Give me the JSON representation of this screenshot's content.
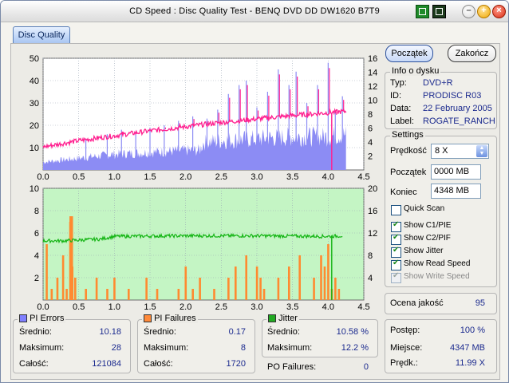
{
  "window": {
    "title": "CD Speed : Disc Quality Test - BENQ    DVD DD DW1620    B7T9"
  },
  "tabs": [
    {
      "label": "Disc Quality"
    }
  ],
  "buttons": {
    "start": "Początek",
    "end": "Zakończ"
  },
  "disc_info": {
    "title": "Info o dysku",
    "rows": [
      {
        "label": "Typ:",
        "value": "DVD+R"
      },
      {
        "label": "ID:",
        "value": "PRODISC R03"
      },
      {
        "label": "Data:",
        "value": "22 February 2005"
      },
      {
        "label": "Label:",
        "value": "ROGATE_RANCH"
      }
    ]
  },
  "settings": {
    "title": "Settings",
    "speed_label": "Prędkość",
    "speed_value": "8 X",
    "start_label": "Początek",
    "start_value": "0000 MB",
    "end_label": "Koniec",
    "end_value": "4348 MB",
    "options": [
      {
        "label": "Quick Scan",
        "checked": false,
        "disabled": false
      },
      {
        "label": "Show C1/PIE",
        "checked": true,
        "disabled": false
      },
      {
        "label": "Show C2/PIF",
        "checked": true,
        "disabled": false
      },
      {
        "label": "Show Jitter",
        "checked": true,
        "disabled": false
      },
      {
        "label": "Show Read Speed",
        "checked": true,
        "disabled": false
      },
      {
        "label": "Show Write Speed",
        "checked": true,
        "disabled": true
      }
    ]
  },
  "quality": {
    "label": "Ocena jakość",
    "value": "95"
  },
  "progress": {
    "rows": [
      {
        "label": "Postęp:",
        "value": "100 %"
      },
      {
        "label": "Miejsce:",
        "value": "4347 MB"
      },
      {
        "label": "Prędk.:",
        "value": "11.99 X"
      }
    ]
  },
  "stats": {
    "pi_errors": {
      "title": "PI Errors",
      "color": "#8080ff",
      "rows": [
        {
          "label": "Średnio:",
          "value": "10.18"
        },
        {
          "label": "Maksimum:",
          "value": "28"
        },
        {
          "label": "Całość:",
          "value": "121084"
        }
      ]
    },
    "pi_failures": {
      "title": "PI Failures",
      "color": "#ff8a3a",
      "rows": [
        {
          "label": "Średnio:",
          "value": "0.17"
        },
        {
          "label": "Maksimum:",
          "value": "8"
        },
        {
          "label": "Całość:",
          "value": "1720"
        }
      ]
    },
    "jitter": {
      "title": "Jitter",
      "color": "#22aa22",
      "rows": [
        {
          "label": "Średnio:",
          "value": "10.58 %"
        },
        {
          "label": "Maksimum:",
          "value": "12.2 %"
        }
      ]
    },
    "po_failures": {
      "label": "PO Failures:",
      "value": "0"
    }
  },
  "colors": {
    "upper_bg": "#ffffff",
    "lower_bg": "#c4f5c4",
    "pie_fill": "#8c8cf4",
    "read_speed": "#ff1f8f",
    "pif_fill": "#ff8a30",
    "jitter": "#13b413"
  },
  "chart_data": [
    {
      "type": "bar",
      "description_series": "PI Errors (bars) with read speed line",
      "x_ticks": [
        "0.0",
        "0.5",
        "1.0",
        "1.5",
        "2.0",
        "2.5",
        "3.0",
        "3.5",
        "4.0",
        "4.5"
      ],
      "xlim": [
        0,
        4.5
      ],
      "y_left_ticks": [
        "10",
        "20",
        "30",
        "40",
        "50"
      ],
      "ylim_left": [
        0,
        50
      ],
      "y_right_ticks": [
        "2",
        "4",
        "6",
        "8",
        "10",
        "12",
        "14",
        "16"
      ],
      "ylim_right": [
        0,
        16
      ],
      "pie_profile": {
        "x": [
          0.0,
          0.5,
          1.0,
          1.5,
          2.0,
          2.2,
          2.25,
          2.5,
          3.0,
          3.5,
          4.0,
          4.15,
          4.25
        ],
        "y": [
          4,
          6,
          8,
          9,
          10,
          10,
          14,
          15,
          16,
          17,
          17,
          18,
          18
        ]
      },
      "pie_spikes": {
        "x": [
          0.6,
          0.9,
          1.1,
          1.3,
          1.5,
          1.7,
          1.9,
          2.1,
          2.3,
          2.45,
          2.6,
          2.75,
          2.85,
          3.0,
          3.15,
          3.3,
          3.45,
          3.55,
          3.7,
          3.85,
          4.0,
          4.1,
          4.2
        ],
        "y": [
          14,
          16,
          18,
          17,
          19,
          20,
          22,
          24,
          23,
          27,
          34,
          38,
          40,
          28,
          35,
          45,
          38,
          44,
          30,
          38,
          48,
          26,
          33
        ]
      },
      "read_speed": {
        "x": [
          0.0,
          0.5,
          1.0,
          1.5,
          2.0,
          2.5,
          3.0,
          3.5,
          4.0,
          4.25
        ],
        "y": [
          3.3,
          4.2,
          4.9,
          5.6,
          6.2,
          6.8,
          7.3,
          7.8,
          8.2,
          8.4
        ]
      }
    },
    {
      "type": "bar",
      "description_series": "PI Failures (bars) with jitter line",
      "x_ticks": [
        "0.0",
        "0.5",
        "1.0",
        "1.5",
        "2.0",
        "2.5",
        "3.0",
        "3.5",
        "4.0",
        "4.5"
      ],
      "xlim": [
        0,
        4.5
      ],
      "y_left_ticks": [
        "2",
        "4",
        "6",
        "8",
        "10"
      ],
      "ylim_left": [
        0,
        10
      ],
      "y_right_ticks": [
        "4",
        "8",
        "12",
        "16",
        "20"
      ],
      "ylim_right": [
        0,
        20
      ],
      "pif_bars": {
        "x": [
          0.05,
          0.12,
          0.2,
          0.28,
          0.33,
          0.38,
          0.41,
          0.45,
          0.6,
          0.75,
          0.9,
          1.0,
          1.2,
          1.45,
          1.6,
          1.9,
          2.0,
          2.1,
          2.2,
          2.4,
          2.6,
          2.7,
          2.85,
          3.0,
          3.05,
          3.1,
          3.3,
          3.45,
          3.6,
          3.8,
          3.9,
          3.95,
          4.0,
          4.05,
          4.1,
          4.15
        ],
        "y": [
          5,
          1,
          2,
          4,
          1,
          7,
          3,
          2,
          1,
          2,
          1,
          2,
          1,
          2,
          1,
          1,
          3,
          1,
          2,
          1,
          2,
          3,
          4,
          3,
          2,
          1,
          2,
          3,
          4,
          2,
          4,
          3,
          5,
          1,
          2,
          1
        ]
      },
      "jitter": {
        "x": [
          0.0,
          0.3,
          0.6,
          0.8,
          1.0,
          2.0,
          3.0,
          4.0,
          4.2
        ],
        "y": [
          10.6,
          10.6,
          10.8,
          10.9,
          11.4,
          11.5,
          11.5,
          11.4,
          11.5
        ]
      }
    }
  ]
}
